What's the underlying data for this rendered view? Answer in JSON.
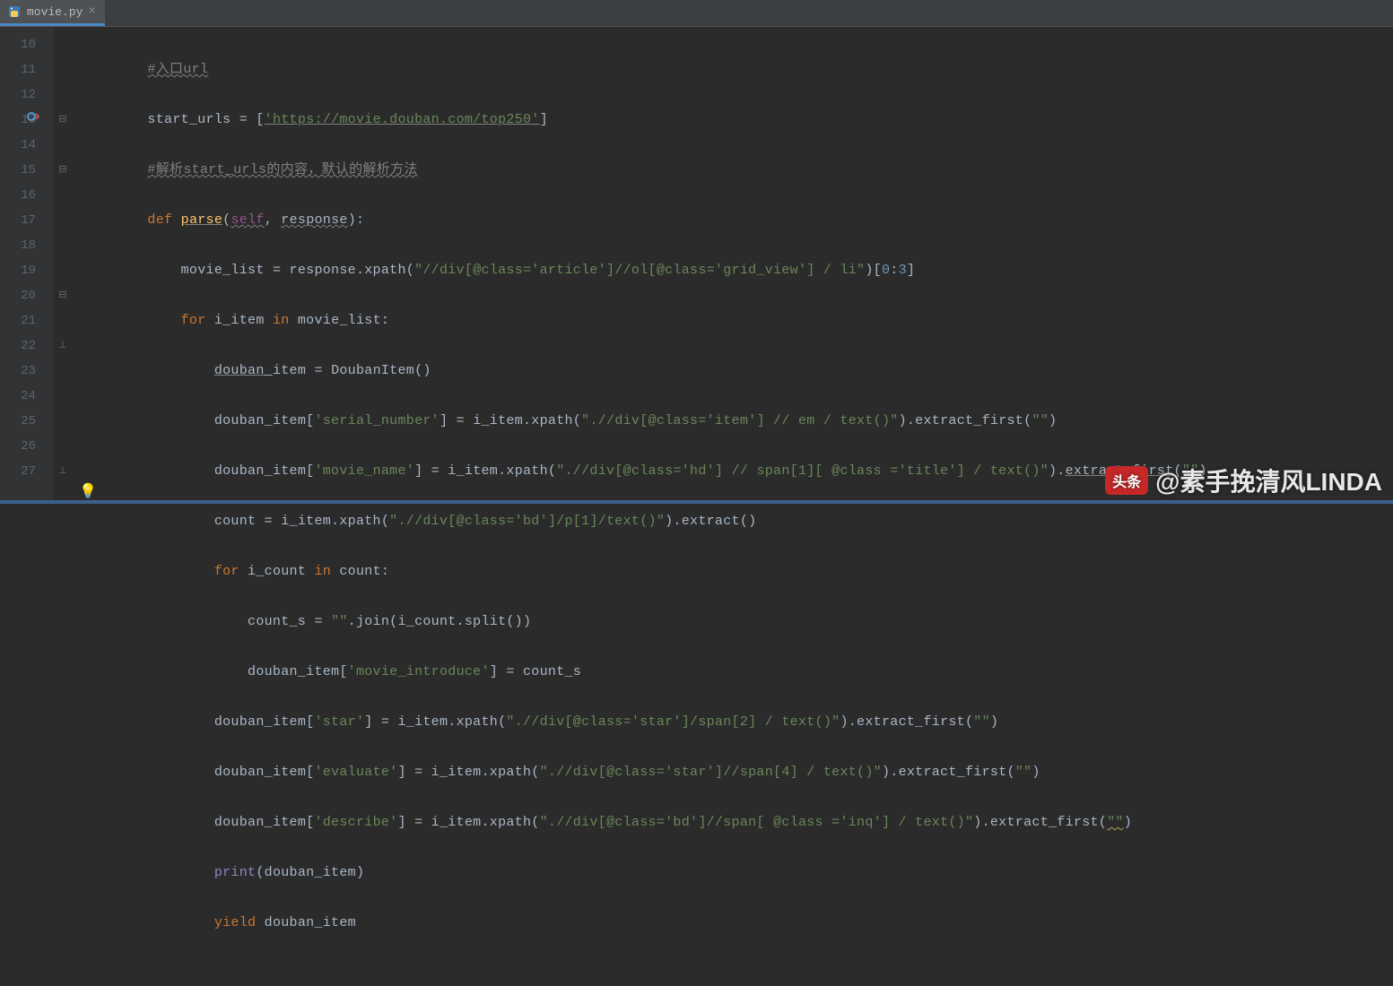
{
  "tab": {
    "label": "movie.py",
    "close": "×"
  },
  "gutter": {
    "start": 10,
    "end": 27
  },
  "watermark": {
    "badge": "头条",
    "text": "@素手挽清风LINDA"
  },
  "code": {
    "l10": {
      "comment": "#入口url"
    },
    "l11": {
      "ident": "start_urls = [",
      "str": "'https://movie.douban.com/top250'",
      "end": "]"
    },
    "l12": {
      "comment": "#解析start_urls的内容，默认的解析方法"
    },
    "l13": {
      "kw": "def ",
      "fn": "parse",
      "paren_o": "(",
      "self": "self",
      "comma": ", ",
      "arg": "response",
      "paren_c": "):"
    },
    "l14": {
      "a": "movie_list = response.xpath(",
      "s": "\"//div[@class='article']//ol[@class='grid_view'] / li\"",
      "b": ")[",
      "n1": "0",
      "colon": ":",
      "n2": "3",
      "c": "]"
    },
    "l15": {
      "kw1": "for",
      "id1": " i_item ",
      "kw2": "in",
      "id2": " movie_list:"
    },
    "l16": {
      "a": "douban_",
      "b": "item = DoubanItem()"
    },
    "l17": {
      "a": "douban_item[",
      "k": "'serial_number'",
      "b": "] = i_item.xpath(",
      "s": "\".//div[@class='item'] // em / text()\"",
      "c": ").extract_first(",
      "e": "\"\"",
      "d": ")"
    },
    "l18": {
      "a": "douban_item[",
      "k": "'movie_name'",
      "b": "] = i_item.xpath(",
      "s": "\".//div[@class='hd'] // span[1][ @class ='title'] / text()\"",
      "c": ").",
      "fn": "extract_first",
      "d": "(",
      "e": "\"\"",
      "f": ")"
    },
    "l19": {
      "a": "count = i_item.xpath(",
      "s": "\".//div[@class='bd']/p[1]/text()\"",
      "b": ").extract()"
    },
    "l20": {
      "kw1": "for",
      "id1": " i_count ",
      "kw2": "in",
      "id2": " count:"
    },
    "l21": {
      "a": "count_s = ",
      "s": "\"\"",
      "b": ".join(i_count.split())"
    },
    "l22": {
      "a": "douban_item[",
      "k": "'movie_introduce'",
      "b": "] = count_s"
    },
    "l23": {
      "a": "douban_item[",
      "k": "'star'",
      "b": "] = i_item.xpath(",
      "s": "\".//div[@class='star']/span[2] / text()\"",
      "c": ").extract_first(",
      "e": "\"\"",
      "d": ")"
    },
    "l24": {
      "a": "douban_item[",
      "k": "'evaluate'",
      "b": "] = i_item.xpath(",
      "s": "\".//div[@class='star']//span[4] / text()\"",
      "c": ").extract_first(",
      "e": "\"\"",
      "d": ")"
    },
    "l25": {
      "a": "douban_item[",
      "k": "'describe'",
      "b": "] = i_item.xpath(",
      "s": "\".//div[@class='bd']//span[ @class ='inq'] / text()\"",
      "c": ").extract_first(",
      "e": "\"\"",
      "d": ")"
    },
    "l26": {
      "fn": "print",
      "a": "(douban_item)"
    },
    "l27": {
      "kw": "yield ",
      "id": "douban_item"
    }
  }
}
